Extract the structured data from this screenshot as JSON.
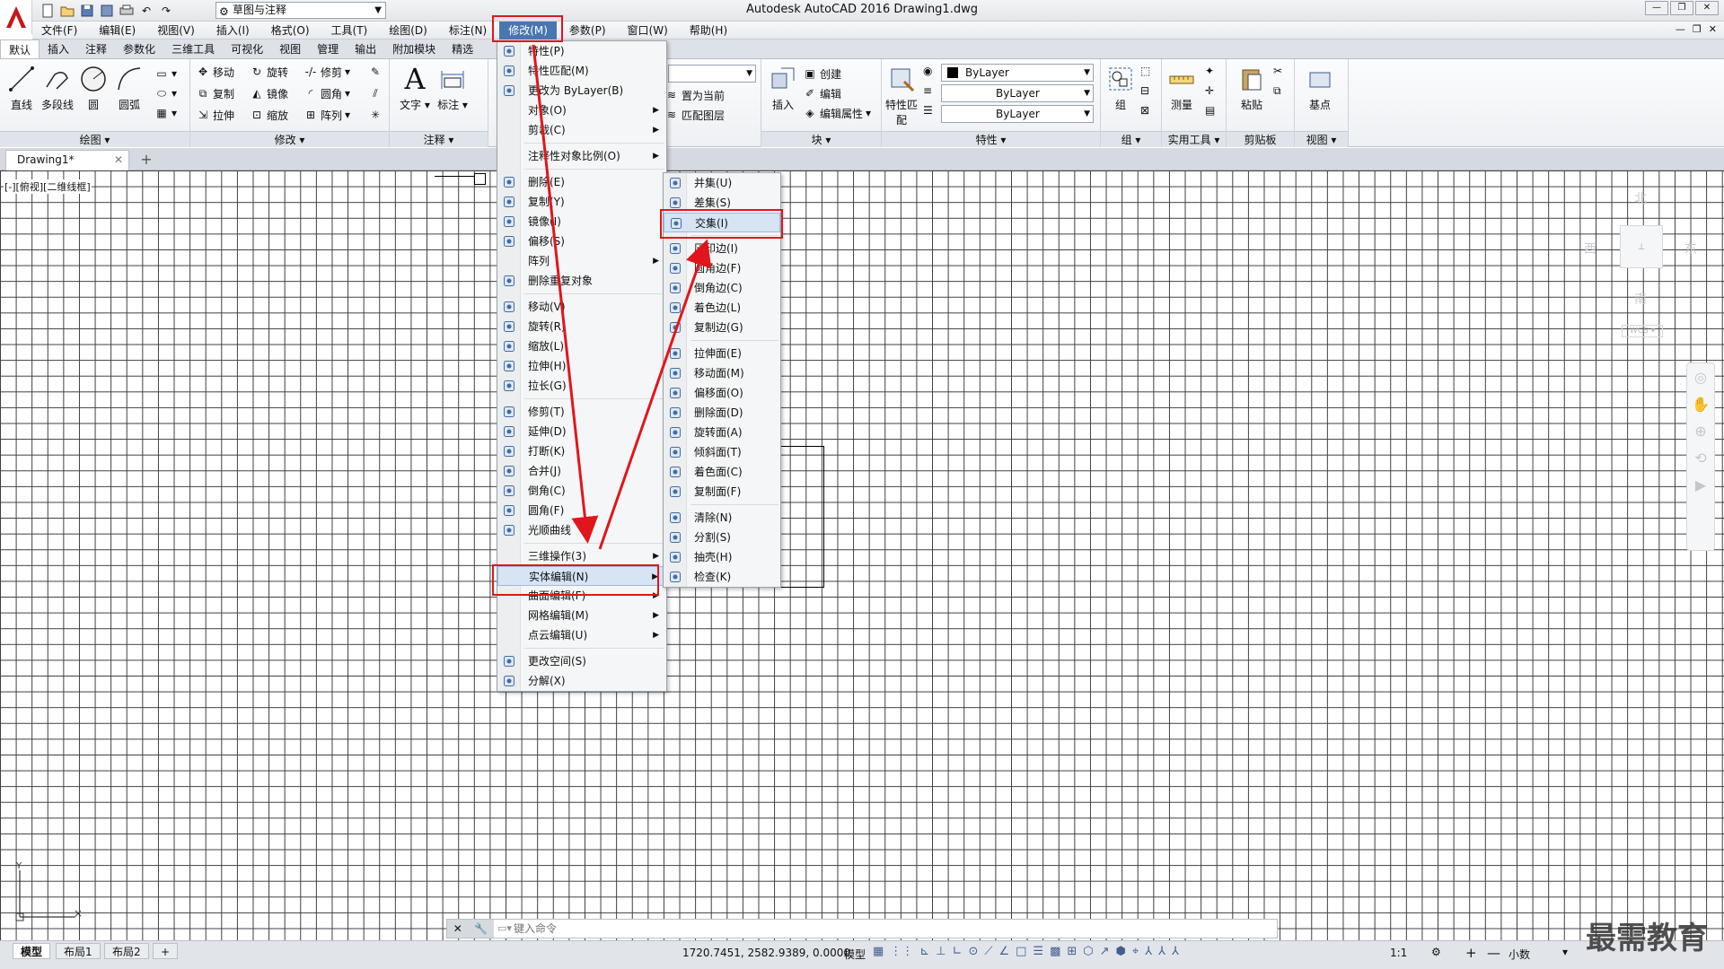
{
  "titlebar": {
    "title": "Autodesk AutoCAD 2016    Drawing1.dwg",
    "workspace": "草图与注释",
    "logo_icon": "autocad-a-logo-icon"
  },
  "menubar": [
    "文件(F)",
    "编辑(E)",
    "视图(V)",
    "插入(I)",
    "格式(O)",
    "工具(T)",
    "绘图(D)",
    "标注(N)",
    "修改(M)",
    "参数(P)",
    "窗口(W)",
    "帮助(H)"
  ],
  "active_menu": "修改(M)",
  "ribbon_tabs": [
    "默认",
    "插入",
    "注释",
    "参数化",
    "三维工具",
    "可视化",
    "视图",
    "管理",
    "输出",
    "附加模块",
    "精选"
  ],
  "ribbon": {
    "draw": {
      "title": "绘图",
      "tools": [
        "直线",
        "多段线",
        "圆",
        "圆弧"
      ]
    },
    "modify": {
      "title": "修改",
      "row1": [
        "移动",
        "旋转",
        "修剪"
      ],
      "row2": [
        "复制",
        "镜像",
        "圆角"
      ],
      "row3": [
        "拉伸",
        "缩放",
        "阵列"
      ]
    },
    "annotation": {
      "title": "注释",
      "tools": [
        "文字",
        "标注"
      ]
    },
    "layers": {
      "row1": "置为当前",
      "row2": "匹配图层"
    },
    "block": {
      "title": "块",
      "insert": "插入",
      "create": "创建",
      "edit": "编辑",
      "edit_attr": "编辑属性"
    },
    "properties": {
      "title": "特性",
      "match": "特性匹配",
      "color": "ByLayer",
      "linetype": "ByLayer",
      "lineweight": "ByLayer"
    },
    "groups": {
      "title": "组",
      "tool": "组"
    },
    "utilities": {
      "title": "实用工具",
      "tool": "测量"
    },
    "clipboard": {
      "title": "剪贴板",
      "tool": "粘贴"
    },
    "view": {
      "title": "视图",
      "tool": "基点"
    }
  },
  "file_tab": "Drawing1*",
  "viewport_label": "[-][俯视][二维线框]",
  "viewcube": {
    "north": "北",
    "south": "南",
    "east": "东",
    "west": "西",
    "wcs": "WCS"
  },
  "modify_menu": {
    "items": [
      {
        "label": "特性(P)",
        "icon": "properties-icon"
      },
      {
        "label": "特性匹配(M)",
        "icon": "match-properties-icon"
      },
      {
        "label": "更改为 ByLayer(B)",
        "icon": "bylayer-icon"
      },
      {
        "label": "对象(O)",
        "submenu": true
      },
      {
        "label": "剪裁(C)",
        "submenu": true
      },
      {
        "sep": true
      },
      {
        "label": "注释性对象比例(O)",
        "submenu": true
      },
      {
        "sep": true
      },
      {
        "label": "删除(E)",
        "icon": "erase-icon"
      },
      {
        "label": "复制(Y)",
        "icon": "copy-icon"
      },
      {
        "label": "镜像(I)",
        "icon": "mirror-icon"
      },
      {
        "label": "偏移(S)",
        "icon": "offset-icon"
      },
      {
        "label": "阵列",
        "submenu": true
      },
      {
        "label": "删除重复对象",
        "icon": "overkill-icon"
      },
      {
        "sep": true
      },
      {
        "label": "移动(V)",
        "icon": "move-icon"
      },
      {
        "label": "旋转(R)",
        "icon": "rotate-icon"
      },
      {
        "label": "缩放(L)",
        "icon": "scale-icon"
      },
      {
        "label": "拉伸(H)",
        "icon": "stretch-icon"
      },
      {
        "label": "拉长(G)",
        "icon": "lengthen-icon"
      },
      {
        "sep": true
      },
      {
        "label": "修剪(T)",
        "icon": "trim-icon"
      },
      {
        "label": "延伸(D)",
        "icon": "extend-icon"
      },
      {
        "label": "打断(K)",
        "icon": "break-icon"
      },
      {
        "label": "合并(J)",
        "icon": "join-icon"
      },
      {
        "label": "倒角(C)",
        "icon": "chamfer-icon"
      },
      {
        "label": "圆角(F)",
        "icon": "fillet-icon"
      },
      {
        "label": "光顺曲线",
        "icon": "blend-curve-icon"
      },
      {
        "sep": true
      },
      {
        "label": "三维操作(3)",
        "submenu": true
      },
      {
        "label": "实体编辑(N)",
        "submenu": true,
        "highlight": true
      },
      {
        "label": "曲面编辑(F)",
        "submenu": true
      },
      {
        "label": "网格编辑(M)",
        "submenu": true
      },
      {
        "label": "点云编辑(U)",
        "submenu": true
      },
      {
        "sep": true
      },
      {
        "label": "更改空间(S)",
        "icon": "change-space-icon"
      },
      {
        "label": "分解(X)",
        "icon": "explode-icon"
      }
    ]
  },
  "solid_edit_menu": {
    "items": [
      {
        "label": "并集(U)",
        "icon": "union-icon"
      },
      {
        "label": "差集(S)",
        "icon": "subtract-icon"
      },
      {
        "label": "交集(I)",
        "icon": "intersect-icon",
        "highlight": true
      },
      {
        "sep": true
      },
      {
        "label": "压印边(I)",
        "icon": "imprint-icon"
      },
      {
        "label": "圆角边(F)",
        "icon": "fillet-edge-icon"
      },
      {
        "label": "倒角边(C)",
        "icon": "chamfer-edge-icon"
      },
      {
        "label": "着色边(L)",
        "icon": "color-edge-icon"
      },
      {
        "label": "复制边(G)",
        "icon": "copy-edge-icon"
      },
      {
        "sep": true
      },
      {
        "label": "拉伸面(E)",
        "icon": "extrude-face-icon"
      },
      {
        "label": "移动面(M)",
        "icon": "move-face-icon"
      },
      {
        "label": "偏移面(O)",
        "icon": "offset-face-icon"
      },
      {
        "label": "删除面(D)",
        "icon": "delete-face-icon"
      },
      {
        "label": "旋转面(A)",
        "icon": "rotate-face-icon"
      },
      {
        "label": "倾斜面(T)",
        "icon": "taper-face-icon"
      },
      {
        "label": "着色面(C)",
        "icon": "color-face-icon"
      },
      {
        "label": "复制面(F)",
        "icon": "copy-face-icon"
      },
      {
        "sep": true
      },
      {
        "label": "清除(N)",
        "icon": "clean-icon"
      },
      {
        "label": "分割(S)",
        "icon": "separate-icon"
      },
      {
        "label": "抽壳(H)",
        "icon": "shell-icon"
      },
      {
        "label": "检查(K)",
        "icon": "check-icon"
      }
    ]
  },
  "command_line": {
    "placeholder": "键入命令"
  },
  "status": {
    "layout_tabs": [
      "模型",
      "布局1",
      "布局2"
    ],
    "coords": "1720.7451, 2582.9389, 0.0000",
    "model": "模型",
    "scale": "1:1",
    "units": "小数"
  },
  "watermark": "最需教育",
  "colors": {
    "highlight_red": "#e0161c",
    "accent": "#4976b0"
  }
}
